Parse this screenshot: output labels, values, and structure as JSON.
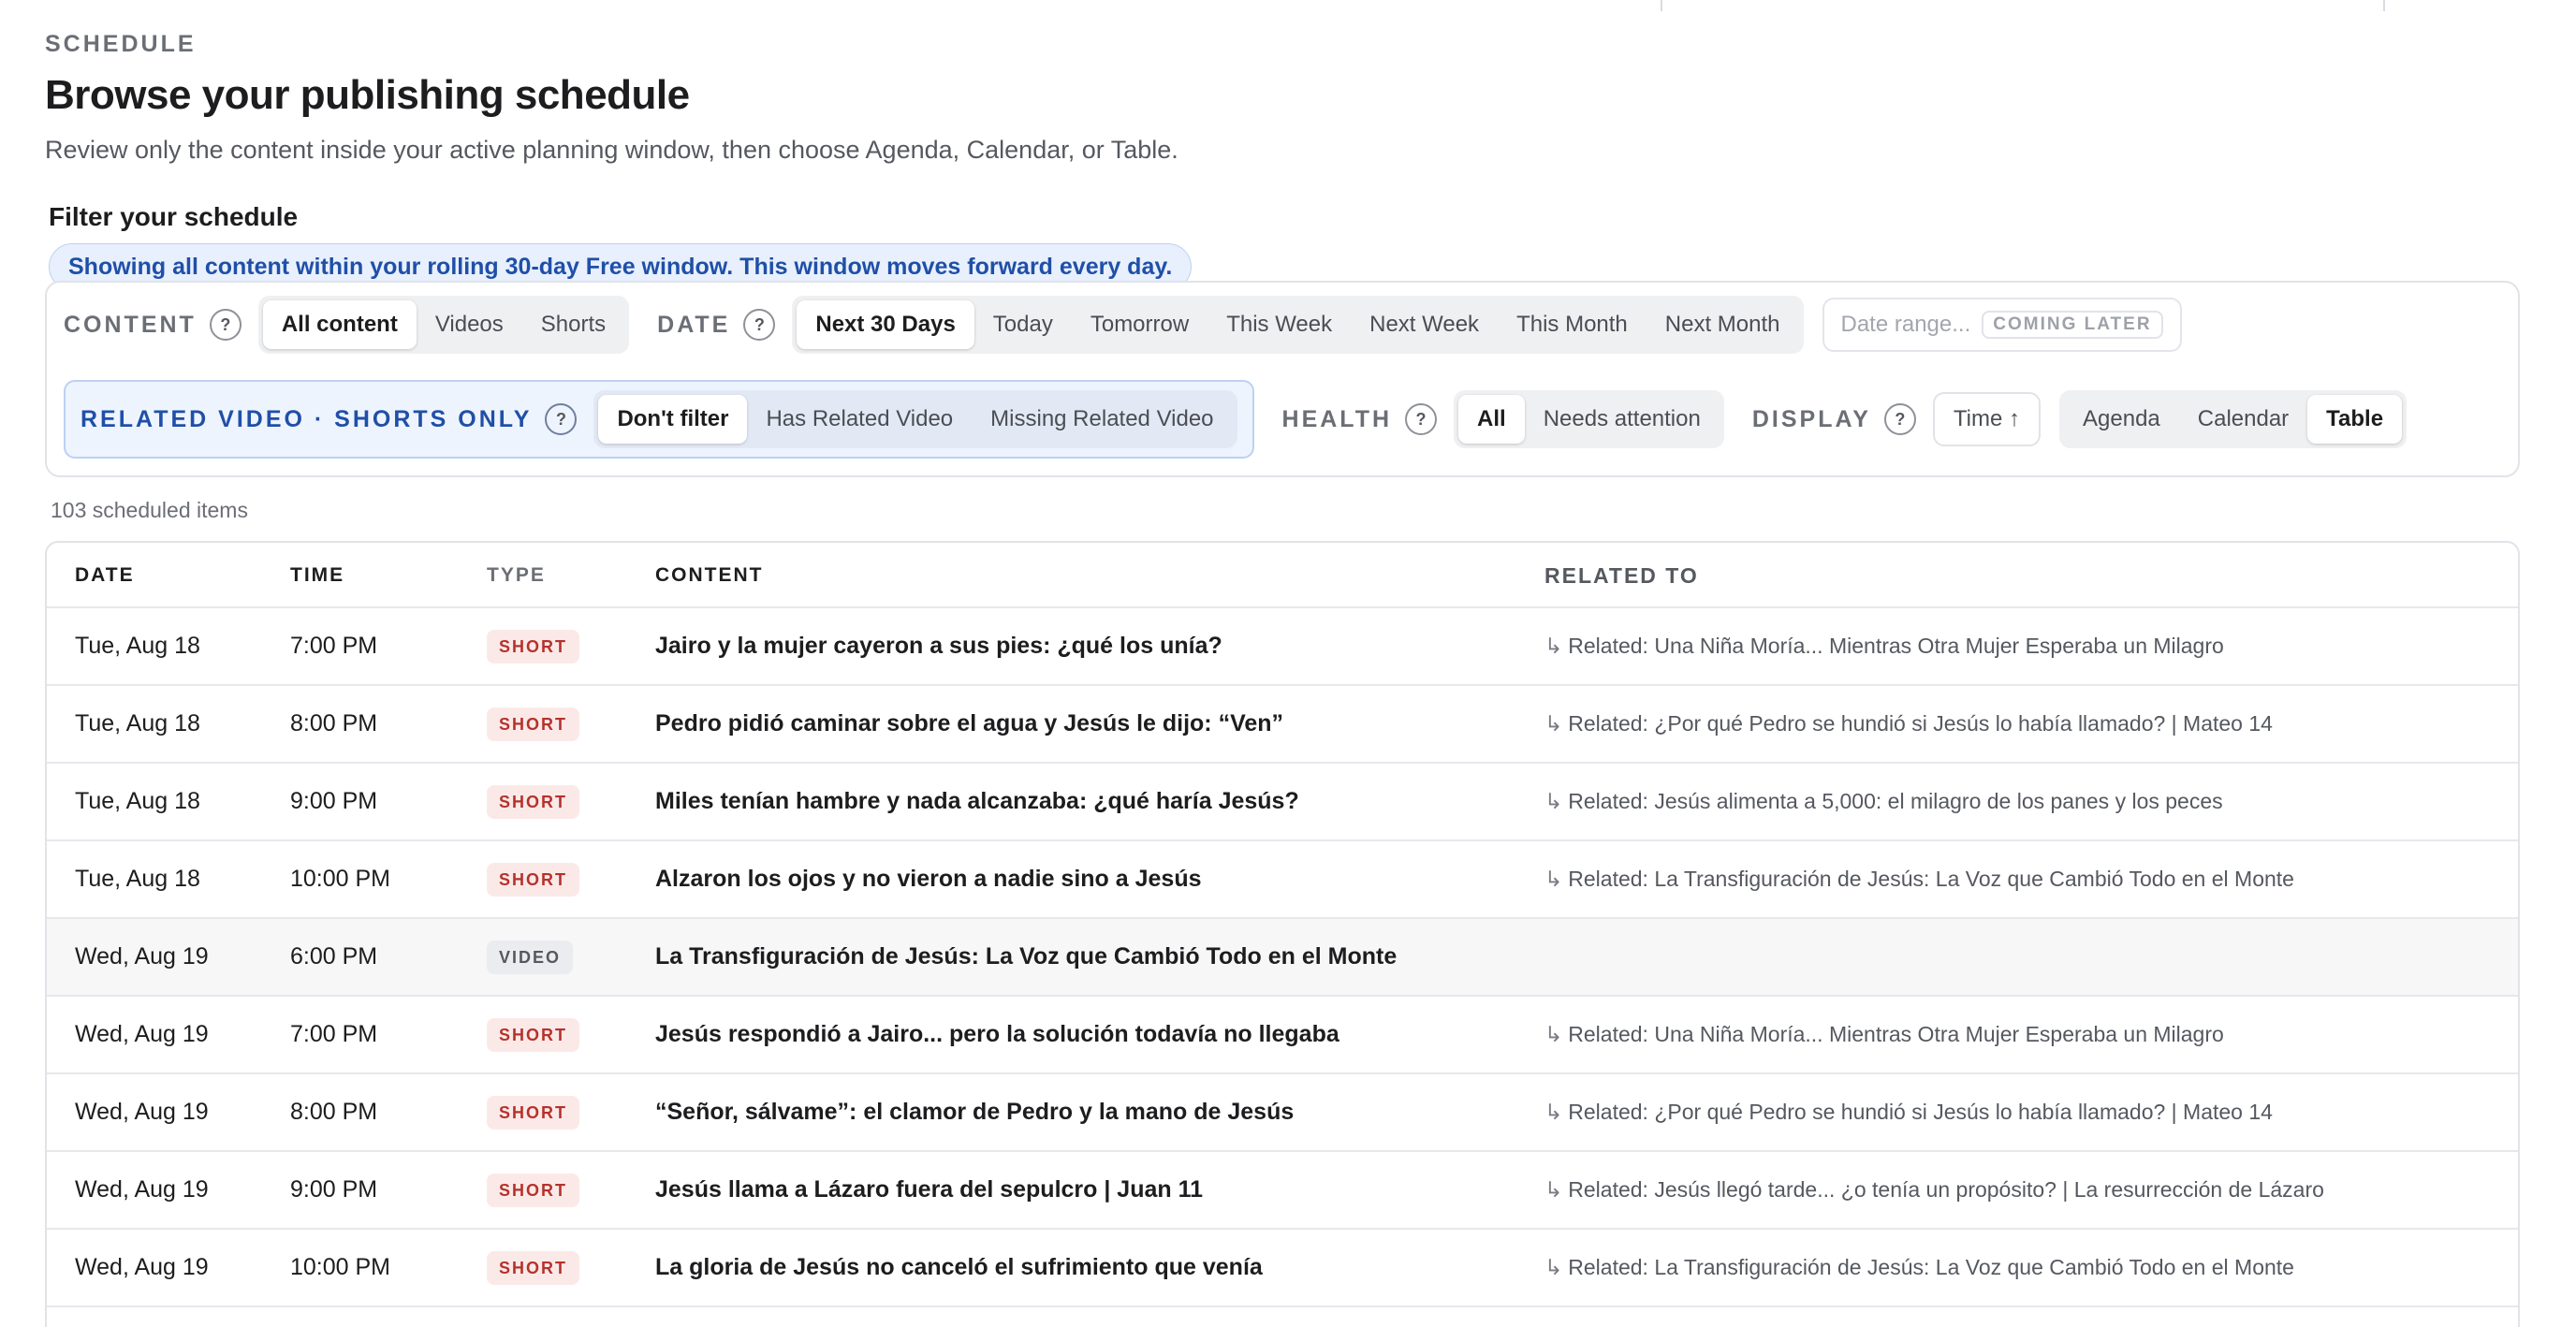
{
  "header": {
    "eyebrow": "SCHEDULE",
    "title": "Browse your publishing schedule",
    "subtitle": "Review only the content inside your active planning window, then choose Agenda, Calendar, or Table."
  },
  "filters": {
    "title": "Filter your schedule",
    "banner": "Showing all content within your rolling 30-day Free window. This window moves forward every day.",
    "content": {
      "label": "CONTENT",
      "help": "?",
      "options": [
        "All content",
        "Videos",
        "Shorts"
      ],
      "selected": "All content"
    },
    "date": {
      "label": "DATE",
      "help": "?",
      "options": [
        "Next 30 Days",
        "Today",
        "Tomorrow",
        "This Week",
        "Next Week",
        "This Month",
        "Next Month"
      ],
      "selected": "Next 30 Days"
    },
    "date_range": {
      "placeholder": "Date range...",
      "badge": "COMING LATER"
    },
    "related": {
      "label": "RELATED VIDEO · SHORTS ONLY",
      "help": "?",
      "options": [
        "Don't filter",
        "Has Related Video",
        "Missing Related Video"
      ],
      "selected": "Don't filter"
    },
    "health": {
      "label": "HEALTH",
      "help": "?",
      "options": [
        "All",
        "Needs attention"
      ],
      "selected": "All"
    },
    "display": {
      "label": "DISPLAY",
      "help": "?",
      "sort": "Time ↑",
      "options": [
        "Agenda",
        "Calendar",
        "Table"
      ],
      "selected": "Table"
    }
  },
  "summary": {
    "count_text": "103 scheduled items"
  },
  "table": {
    "columns": [
      "DATE",
      "TIME",
      "TYPE",
      "CONTENT",
      "RELATED TO"
    ],
    "rows": [
      {
        "date": "Tue, Aug 18",
        "time": "7:00 PM",
        "type": "SHORT",
        "content": "Jairo y la mujer cayeron a sus pies: ¿qué los unía?",
        "related": "Related: Una Niña Moría... Mientras Otra Mujer Esperaba un Milagro"
      },
      {
        "date": "Tue, Aug 18",
        "time": "8:00 PM",
        "type": "SHORT",
        "content": "Pedro pidió caminar sobre el agua y Jesús le dijo: “Ven”",
        "related": "Related: ¿Por qué Pedro se hundió si Jesús lo había llamado? | Mateo 14"
      },
      {
        "date": "Tue, Aug 18",
        "time": "9:00 PM",
        "type": "SHORT",
        "content": "Miles tenían hambre y nada alcanzaba: ¿qué haría Jesús?",
        "related": "Related: Jesús alimenta a 5,000: el milagro de los panes y los peces"
      },
      {
        "date": "Tue, Aug 18",
        "time": "10:00 PM",
        "type": "SHORT",
        "content": "Alzaron los ojos y no vieron a nadie sino a Jesús",
        "related": "Related: La Transfiguración de Jesús: La Voz que Cambió Todo en el Monte"
      },
      {
        "date": "Wed, Aug 19",
        "time": "6:00 PM",
        "type": "VIDEO",
        "content": "La Transfiguración de Jesús: La Voz que Cambió Todo en el Monte",
        "related": ""
      },
      {
        "date": "Wed, Aug 19",
        "time": "7:00 PM",
        "type": "SHORT",
        "content": "Jesús respondió a Jairo... pero la solución todavía no llegaba",
        "related": "Related: Una Niña Moría... Mientras Otra Mujer Esperaba un Milagro"
      },
      {
        "date": "Wed, Aug 19",
        "time": "8:00 PM",
        "type": "SHORT",
        "content": "“Señor, sálvame”: el clamor de Pedro y la mano de Jesús",
        "related": "Related: ¿Por qué Pedro se hundió si Jesús lo había llamado? | Mateo 14"
      },
      {
        "date": "Wed, Aug 19",
        "time": "9:00 PM",
        "type": "SHORT",
        "content": "Jesús llama a Lázaro fuera del sepulcro | Juan 11",
        "related": "Related: Jesús llegó tarde... ¿o tenía un propósito? | La resurrección de Lázaro"
      },
      {
        "date": "Wed, Aug 19",
        "time": "10:00 PM",
        "type": "SHORT",
        "content": "La gloria de Jesús no canceló el sufrimiento que venía",
        "related": "Related: La Transfiguración de Jesús: La Voz que Cambió Todo en el Monte"
      }
    ]
  },
  "icons": {
    "related_arrow": "corner-arrow-icon",
    "help": "question-icon"
  },
  "colors": {
    "accent": "#1f4fa8",
    "short_badge": "#b5322b",
    "short_badge_bg": "#fbe9e8",
    "video_badge_bg": "#ebecef"
  }
}
